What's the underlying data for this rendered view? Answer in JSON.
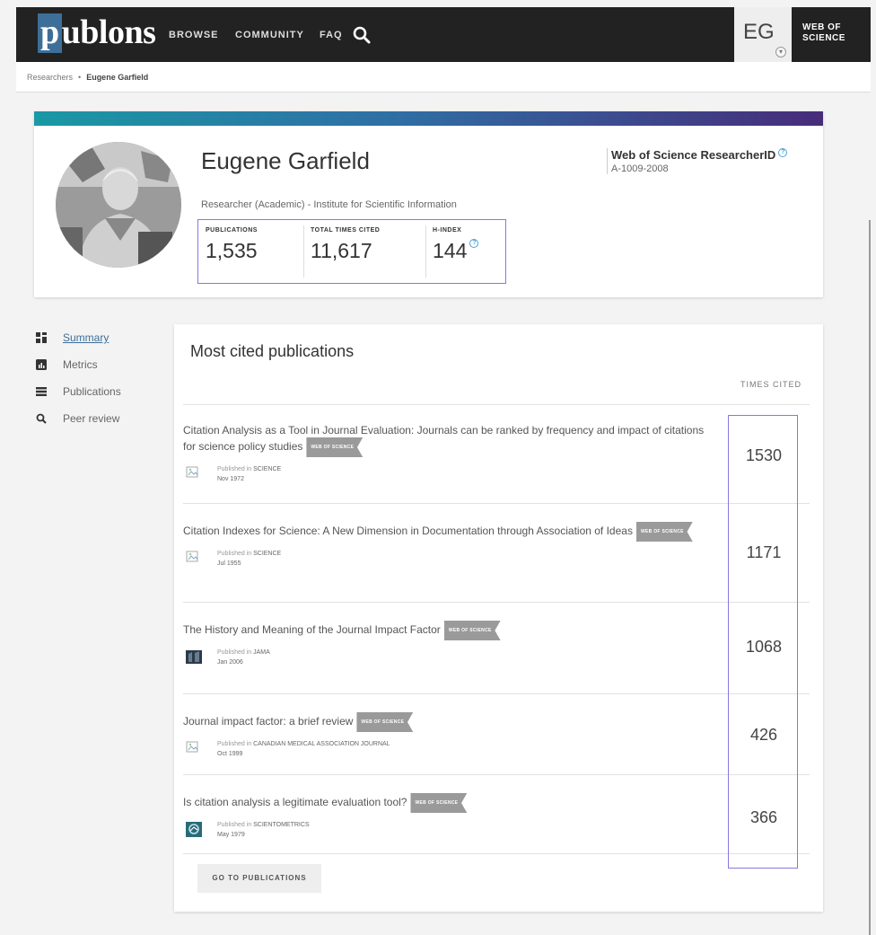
{
  "nav": {
    "logo": "publons",
    "items": [
      "BROWSE",
      "COMMUNITY",
      "FAQ"
    ],
    "user_initials": "EG",
    "wos_link": "WEB OF SCIENCE"
  },
  "breadcrumb": {
    "parent": "Researchers",
    "current": "Eugene Garfield"
  },
  "profile": {
    "name": "Eugene Garfield",
    "affiliation": "Researcher (Academic) - Institute for Scientific Information",
    "metrics": [
      {
        "label": "PUBLICATIONS",
        "value": "1,535"
      },
      {
        "label": "TOTAL TIMES CITED",
        "value": "11,617"
      },
      {
        "label": "H-INDEX",
        "value": "144"
      }
    ],
    "researcher_id_title": "Web of Science ResearcherID",
    "researcher_id": "A-1009-2008"
  },
  "sidebar": {
    "items": [
      {
        "label": "Summary",
        "icon": "summary-icon",
        "active": true
      },
      {
        "label": "Metrics",
        "icon": "metrics-icon"
      },
      {
        "label": "Publications",
        "icon": "publications-icon"
      },
      {
        "label": "Peer review",
        "icon": "search-icon"
      }
    ]
  },
  "main": {
    "title": "Most cited publications",
    "times_cited_header": "TIMES CITED",
    "badge": "WEB OF SCIENCE",
    "published_in": "Published in",
    "publications": [
      {
        "title": "Citation Analysis as a Tool in Journal Evaluation: Journals can be ranked by frequency and impact of citations for science policy studies",
        "journal": "SCIENCE",
        "date": "Nov 1972",
        "cites": "1530",
        "icon": "broken-image-icon"
      },
      {
        "title": "Citation Indexes for Science: A New Dimension in Documentation through Association of Ideas",
        "journal": "SCIENCE",
        "date": "Jul 1955",
        "cites": "1171",
        "icon": "broken-image-icon"
      },
      {
        "title": "The History and Meaning of the Journal Impact Factor",
        "journal": "JAMA",
        "date": "Jan 2006",
        "cites": "1068",
        "icon": "jama-logo-icon"
      },
      {
        "title": "Journal impact factor: a brief review",
        "journal": "CANADIAN MEDICAL ASSOCIATION JOURNAL",
        "date": "Oct 1999",
        "cites": "426",
        "icon": "broken-image-icon"
      },
      {
        "title": "Is citation analysis a legitimate evaluation tool?",
        "journal": "SCIENTOMETRICS",
        "date": "May 1979",
        "cites": "366",
        "icon": "scientometrics-logo-icon"
      }
    ],
    "goto_button": "GO TO PUBLICATIONS"
  },
  "colors": {
    "nav_bg": "#222222",
    "accent_link": "#3e6f98",
    "highlight_border": "#8877e0",
    "badge_gray": "#9a9a9a"
  }
}
